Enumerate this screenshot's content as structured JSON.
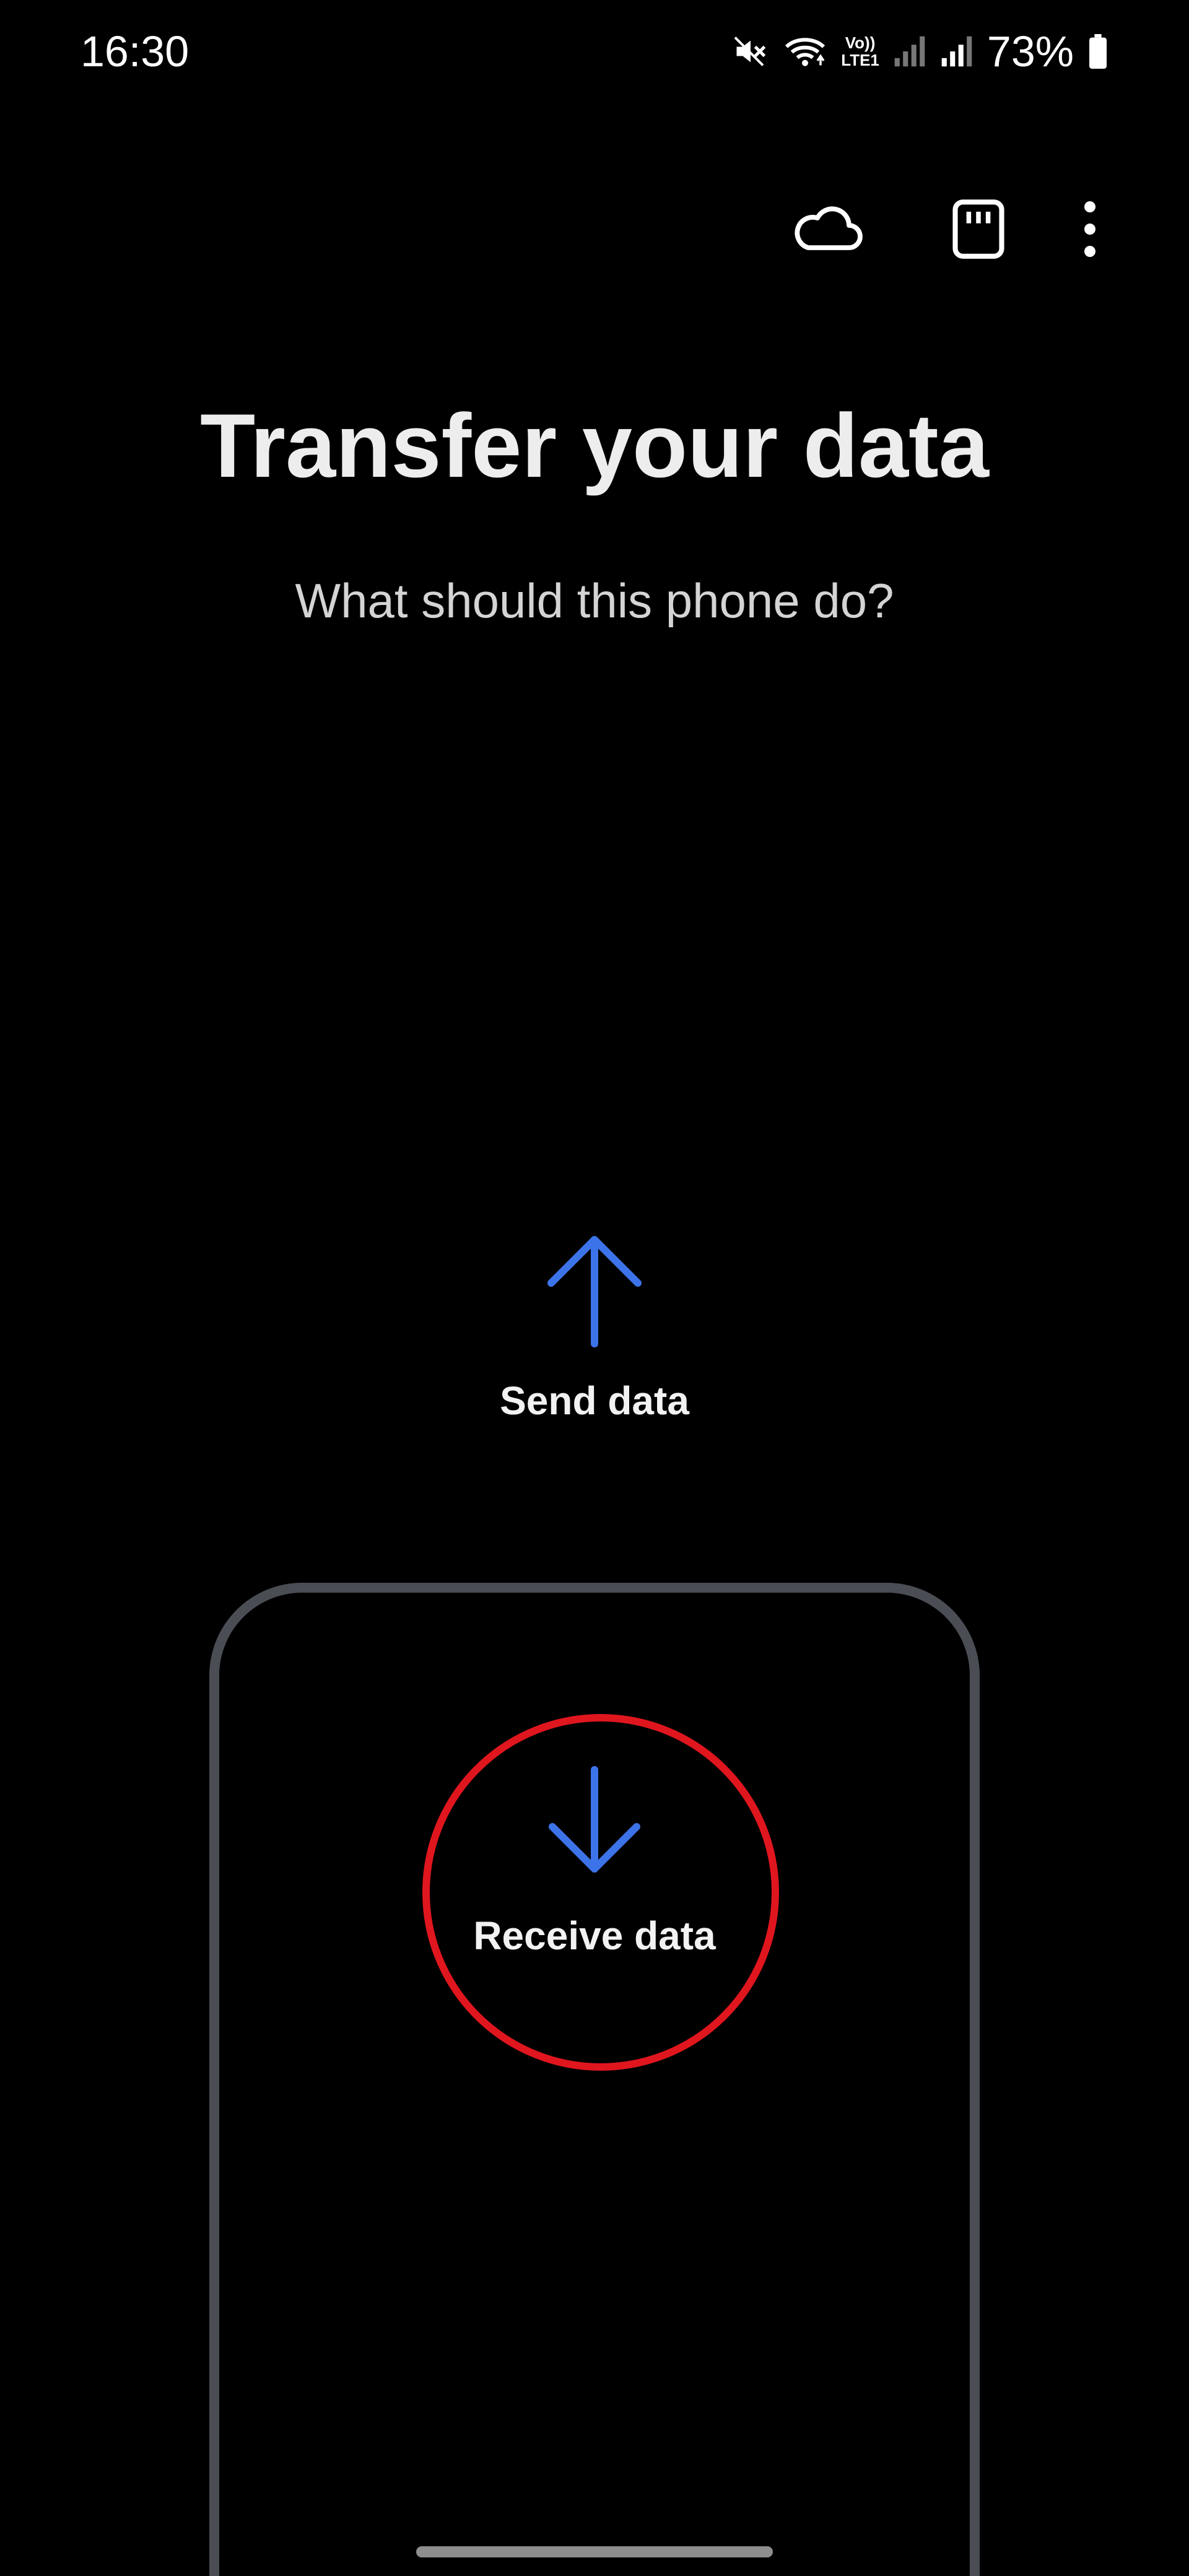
{
  "status_bar": {
    "time": "16:30",
    "volte_top": "Vo))",
    "volte_bottom": "LTE1",
    "battery_percent": "73%",
    "icons": [
      "mute-icon",
      "wifi-icon",
      "volte-icon",
      "signal-weak-icon",
      "signal-icon",
      "battery-icon"
    ]
  },
  "toolbar": {
    "icons": [
      "cloud-icon",
      "sd-card-icon",
      "more-options-icon"
    ]
  },
  "main": {
    "title": "Transfer your data",
    "subtitle": "What should this phone do?"
  },
  "options": {
    "send": {
      "label": "Send data",
      "icon": "arrow-up-icon"
    },
    "receive": {
      "label": "Receive data",
      "icon": "arrow-down-icon"
    }
  },
  "colors": {
    "accent_arrow": "#3d73e8",
    "highlight_ring": "#e0161e",
    "phone_outline": "#4a4d54",
    "background": "#000000"
  }
}
